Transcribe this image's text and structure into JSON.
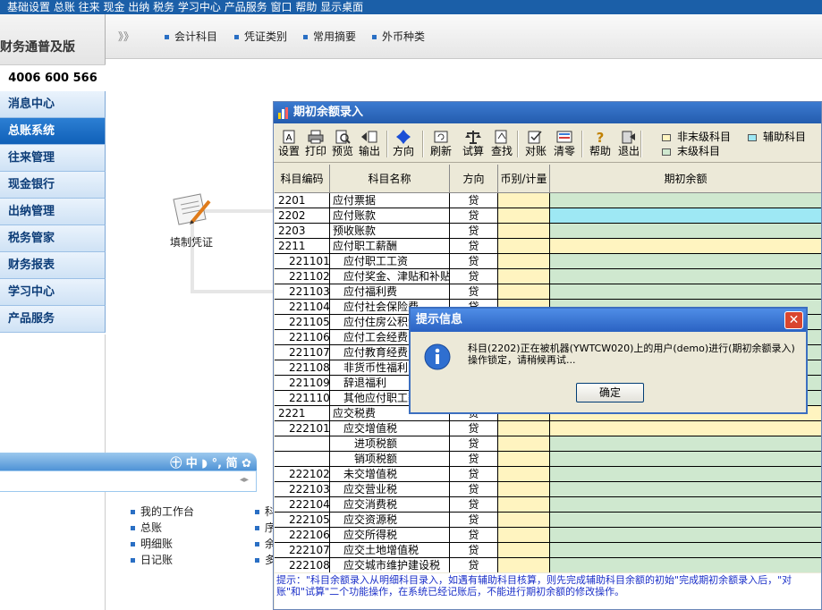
{
  "menubar": {
    "text": "基础设置  总账  往来  现金  出纳  税务  学习中心  产品服务  窗口  帮助  显示桌面"
  },
  "brand": {
    "product": "财务通普及版",
    "phone": "4006 600 566"
  },
  "leftnav": {
    "items": [
      {
        "label": "消息中心"
      },
      {
        "label": "总账系统"
      },
      {
        "label": "往来管理"
      },
      {
        "label": "现金银行"
      },
      {
        "label": "出纳管理"
      },
      {
        "label": "税务管家"
      },
      {
        "label": "财务报表"
      },
      {
        "label": "学习中心"
      },
      {
        "label": "产品服务"
      }
    ],
    "active_index": 1
  },
  "topstrip": {
    "arrows": "》》",
    "items": [
      {
        "label": "会计科目"
      },
      {
        "label": "凭证类别"
      },
      {
        "label": "常用摘要"
      },
      {
        "label": "外币种类"
      }
    ]
  },
  "canvas": {
    "voucher_label": "填制凭证"
  },
  "chat": {
    "tools": "㊉ 中 ◗ °, 简 ✿",
    "scroll": "◂▸"
  },
  "links_left": [
    {
      "label": "我的工作台"
    },
    {
      "label": "总账"
    },
    {
      "label": "明细账"
    },
    {
      "label": "日记账"
    }
  ],
  "links_right": [
    {
      "label": "科"
    },
    {
      "label": "序"
    },
    {
      "label": "余"
    },
    {
      "label": "多"
    }
  ],
  "window": {
    "title": "期初余额录入",
    "toolbar": [
      {
        "label": "设置",
        "icon": "settings-icon"
      },
      {
        "label": "打印",
        "icon": "print-icon"
      },
      {
        "label": "预览",
        "icon": "preview-icon"
      },
      {
        "label": "输出",
        "icon": "export-icon"
      },
      {
        "label": "方向",
        "icon": "direction-icon"
      },
      {
        "label": "刷新",
        "icon": "refresh-icon"
      },
      {
        "label": "试算",
        "icon": "balance-scale-icon"
      },
      {
        "label": "查找",
        "icon": "find-icon"
      },
      {
        "label": "对账",
        "icon": "reconcile-icon"
      },
      {
        "label": "清零",
        "icon": "clear-icon"
      },
      {
        "label": "帮助",
        "icon": "help-icon"
      },
      {
        "label": "退出",
        "icon": "exit-icon"
      }
    ],
    "legend": [
      {
        "label": "非末级科目",
        "color": "#fff4c0"
      },
      {
        "label": "辅助科目",
        "color": "#9ee8f4"
      },
      {
        "label": "末级科目",
        "color": "#cfe8cf"
      }
    ],
    "columns": [
      "科目编码",
      "科目名称",
      "方向",
      "币别/计量",
      "期初余额"
    ],
    "rows": [
      {
        "code": "2201",
        "name": "应付票据",
        "dir": "贷",
        "type": "leaf",
        "indent": 0
      },
      {
        "code": "2202",
        "name": "应付账款",
        "dir": "贷",
        "type": "aux",
        "indent": 0
      },
      {
        "code": "2203",
        "name": "预收账款",
        "dir": "贷",
        "type": "leaf",
        "indent": 0
      },
      {
        "code": "2211",
        "name": "应付职工薪酬",
        "dir": "贷",
        "type": "nonleaf",
        "indent": 0
      },
      {
        "code": "221101",
        "name": "应付职工工资",
        "dir": "贷",
        "type": "leaf",
        "indent": 1
      },
      {
        "code": "221102",
        "name": "应付奖金、津贴和补贴",
        "dir": "贷",
        "type": "leaf",
        "indent": 1
      },
      {
        "code": "221103",
        "name": "应付福利费",
        "dir": "贷",
        "type": "leaf",
        "indent": 1
      },
      {
        "code": "221104",
        "name": "应付社会保险费",
        "dir": "贷",
        "type": "leaf",
        "indent": 1
      },
      {
        "code": "221105",
        "name": "应付住房公积金",
        "dir": "贷",
        "type": "leaf",
        "indent": 1
      },
      {
        "code": "221106",
        "name": "应付工会经费",
        "dir": "贷",
        "type": "leaf",
        "indent": 1
      },
      {
        "code": "221107",
        "name": "应付教育经费",
        "dir": "贷",
        "type": "leaf",
        "indent": 1
      },
      {
        "code": "221108",
        "name": "非货币性福利",
        "dir": "贷",
        "type": "leaf",
        "indent": 1
      },
      {
        "code": "221109",
        "name": "辞退福利",
        "dir": "贷",
        "type": "leaf",
        "indent": 1
      },
      {
        "code": "221110",
        "name": "其他应付职工薪酬",
        "dir": "贷",
        "type": "leaf",
        "indent": 1
      },
      {
        "code": "2221",
        "name": "应交税费",
        "dir": "贷",
        "type": "nonleaf",
        "indent": 0
      },
      {
        "code": "222101",
        "name": "应交增值税",
        "dir": "贷",
        "type": "nonleaf",
        "indent": 1
      },
      {
        "code": "",
        "name": "进项税额",
        "dir": "贷",
        "type": "leaf",
        "indent": 2
      },
      {
        "code": "",
        "name": "销项税额",
        "dir": "贷",
        "type": "leaf",
        "indent": 2
      },
      {
        "code": "222102",
        "name": "未交增值税",
        "dir": "贷",
        "type": "leaf",
        "indent": 1
      },
      {
        "code": "222103",
        "name": "应交营业税",
        "dir": "贷",
        "type": "leaf",
        "indent": 1
      },
      {
        "code": "222104",
        "name": "应交消费税",
        "dir": "贷",
        "type": "leaf",
        "indent": 1
      },
      {
        "code": "222105",
        "name": "应交资源税",
        "dir": "贷",
        "type": "leaf",
        "indent": 1
      },
      {
        "code": "222106",
        "name": "应交所得税",
        "dir": "贷",
        "type": "leaf",
        "indent": 1
      },
      {
        "code": "222107",
        "name": "应交土地增值税",
        "dir": "贷",
        "type": "leaf",
        "indent": 1
      },
      {
        "code": "222108",
        "name": "应交城市维护建设税",
        "dir": "贷",
        "type": "leaf",
        "indent": 1
      }
    ],
    "hint": "提示：\"科目余额录入从明细科目录入，如遇有辅助科目核算，则先完成辅助科目余额的初始\"完成期初余额录入后，\"对账\"和\"试算\"二个功能操作，在系统已经记账后，不能进行期初余额的修改操作。"
  },
  "dialog": {
    "title": "提示信息",
    "close": "✕",
    "message": "科目(2202)正在被机器(YWTCW020)上的用户(demo)进行(期初余额录入)操作锁定，请稍候再试...",
    "ok": "确定"
  }
}
